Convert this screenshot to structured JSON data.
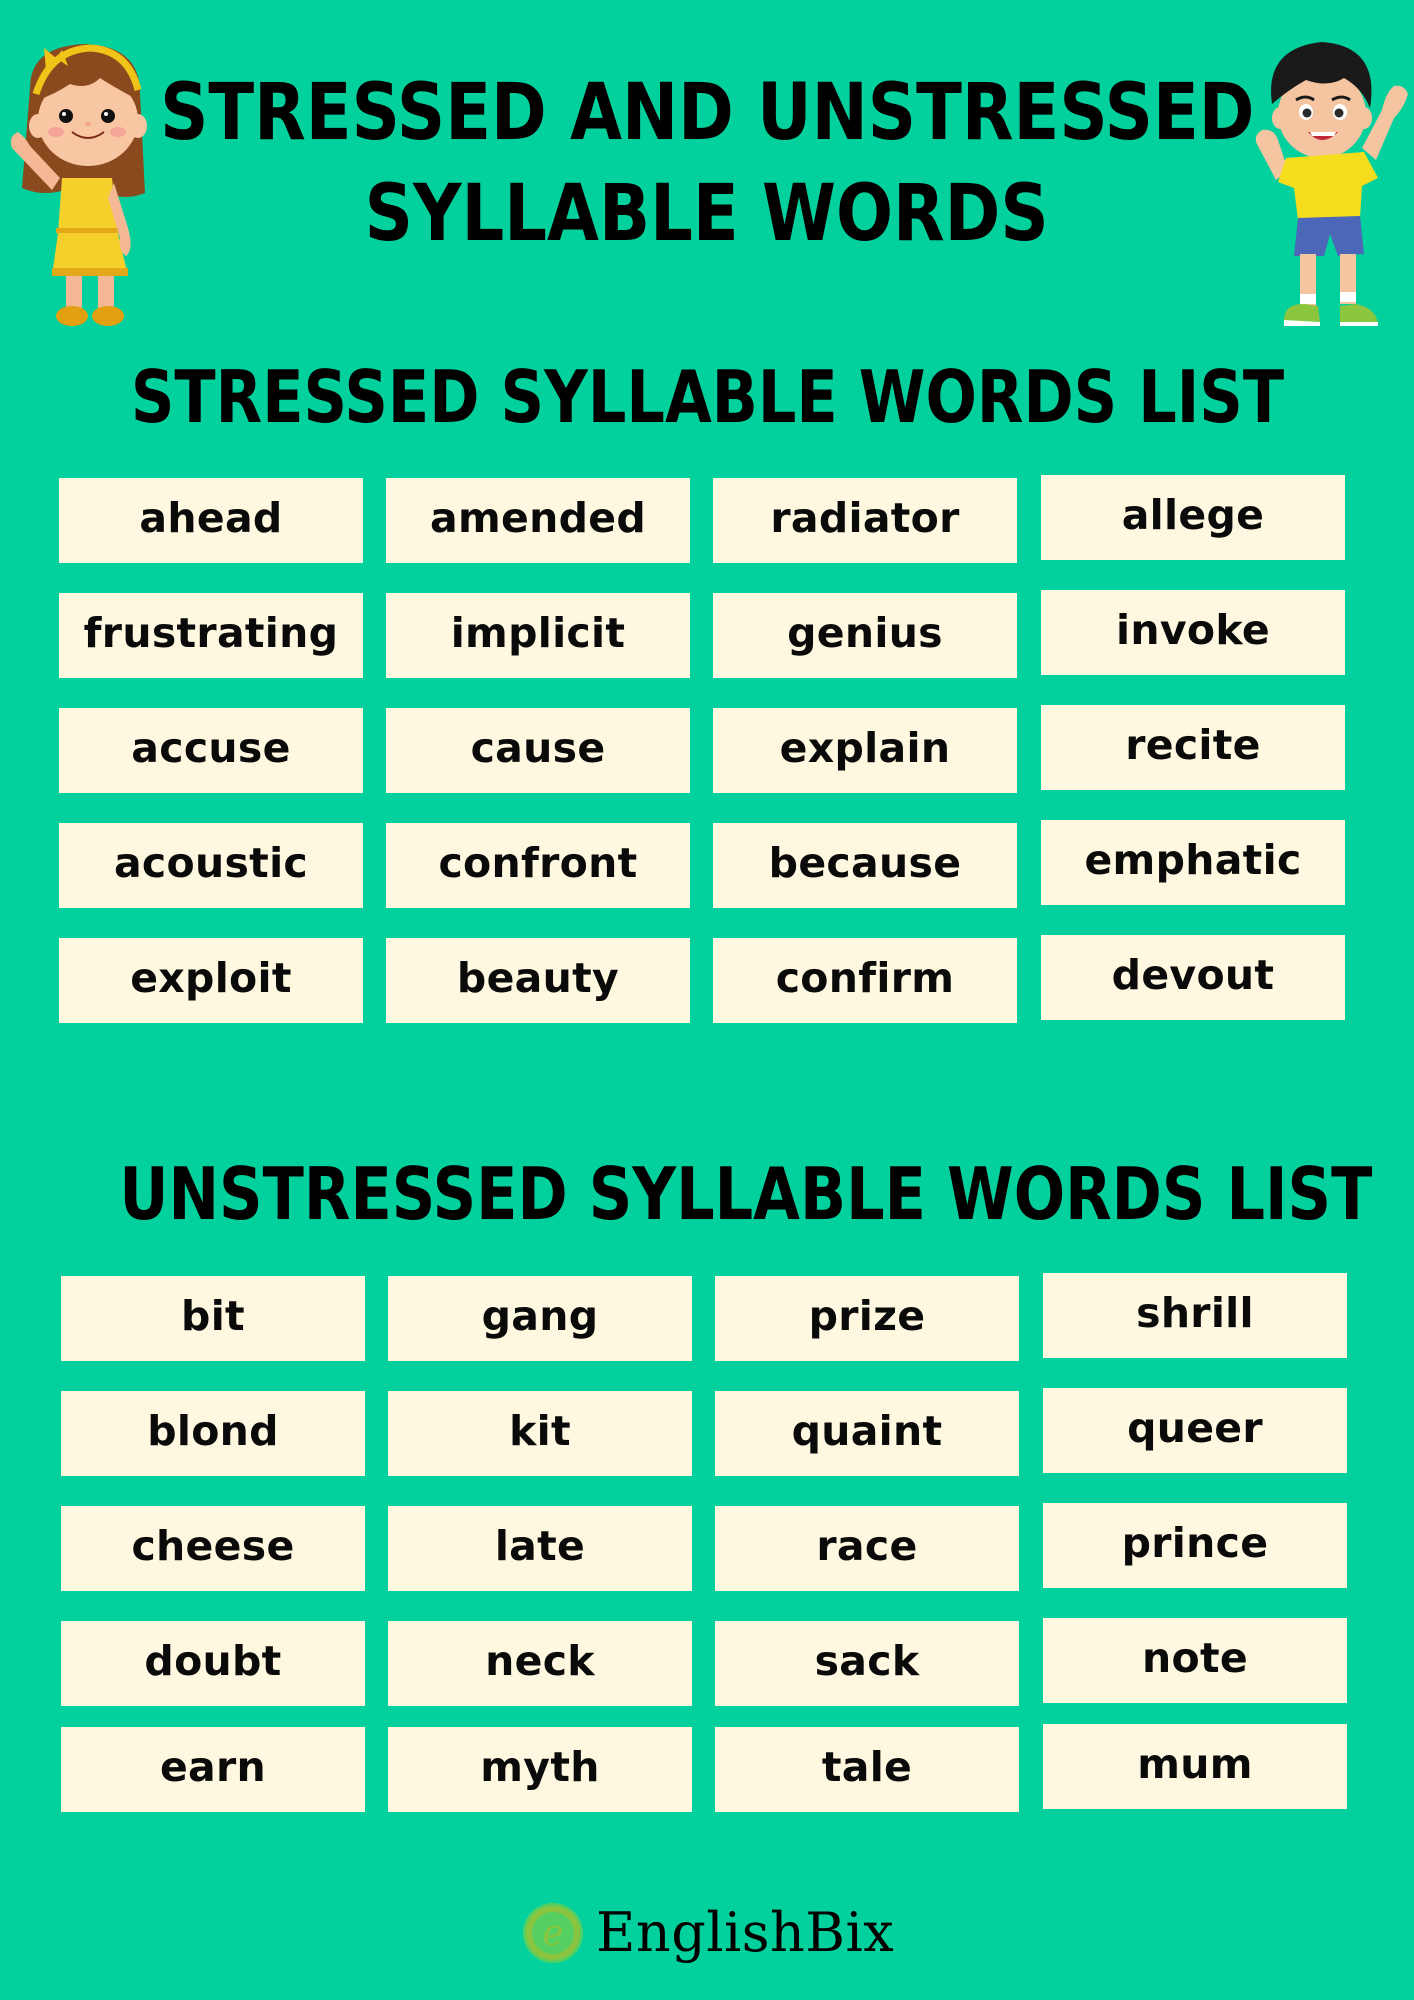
{
  "title": {
    "line1": "STRESSED AND UNSTRESSED",
    "line2": "SYLLABLE WORDS"
  },
  "colors": {
    "background": "#02D19E",
    "box": "#FFF8E0",
    "text": "#000000",
    "logo_accent": "#8BC53F"
  },
  "sections": [
    {
      "heading": "STRESSED SYLLABLE WORDS LIST",
      "rows": [
        [
          "ahead",
          "amended",
          "radiator",
          "allege"
        ],
        [
          "frustrating",
          "implicit",
          "genius",
          "invoke"
        ],
        [
          "accuse",
          "cause",
          "explain",
          "recite"
        ],
        [
          "acoustic",
          "confront",
          "because",
          "emphatic"
        ],
        [
          "exploit",
          "beauty",
          "confirm",
          "devout"
        ]
      ]
    },
    {
      "heading": "UNSTRESSED SYLLABLE WORDS LIST",
      "rows": [
        [
          "bit",
          "gang",
          "prize",
          "shrill"
        ],
        [
          "blond",
          "kit",
          "quaint",
          "queer"
        ],
        [
          "cheese",
          "late",
          "race",
          "prince"
        ],
        [
          "doubt",
          "neck",
          "sack",
          "note"
        ],
        [
          "earn",
          "myth",
          "tale",
          "mum"
        ]
      ]
    }
  ],
  "illustrations": {
    "left": "girl-waving-illustration",
    "right": "boy-waving-illustration"
  },
  "footer": {
    "logo_letter": "e",
    "brand": "EnglishBix"
  }
}
